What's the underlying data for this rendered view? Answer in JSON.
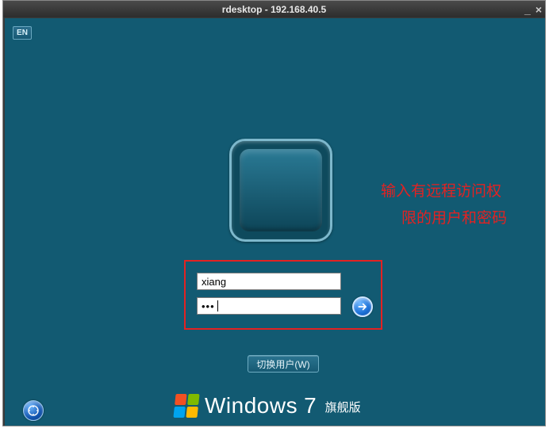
{
  "window": {
    "title": "rdesktop - 192.168.40.5",
    "minimize": "_",
    "close": "×"
  },
  "lang_badge": "EN",
  "login": {
    "username_value": "xiang",
    "password_masked": "•••",
    "switch_user_label": "切换用户(W)"
  },
  "annotation": {
    "line1": "输入有远程访问权",
    "line2": "限的用户和密码"
  },
  "branding": {
    "product": "Windows",
    "version": "7",
    "edition": "旗舰版"
  }
}
